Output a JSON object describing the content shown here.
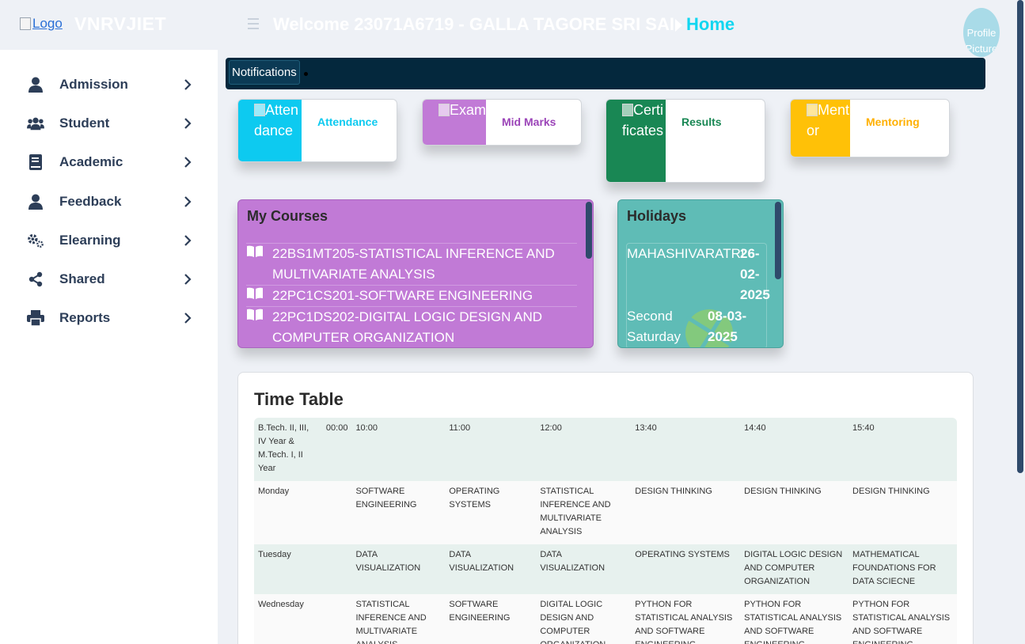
{
  "header": {
    "logo_alt": "Logo",
    "brand": "VNRVJIET",
    "welcome": "Welcome 23071A6719 - GALLA TAGORE SRI SAI",
    "breadcrumb": "Home",
    "avatar_alt": "Profile Picture"
  },
  "sidebar": {
    "items": [
      {
        "label": "Admission",
        "icon": "user-icon"
      },
      {
        "label": "Student",
        "icon": "users-icon"
      },
      {
        "label": "Academic",
        "icon": "book-icon"
      },
      {
        "label": "Feedback",
        "icon": "user-icon"
      },
      {
        "label": "Elearning",
        "icon": "gears-icon"
      },
      {
        "label": "Shared",
        "icon": "share-icon"
      },
      {
        "label": "Reports",
        "icon": "printer-icon"
      }
    ]
  },
  "notifications": {
    "label": "Notifications"
  },
  "quick_cards": [
    {
      "img_alt": "Attendance",
      "label": "Attendance",
      "color": "#0dcaf0"
    },
    {
      "img_alt": "Exam",
      "label": "Mid Marks",
      "color": "#c17ad6"
    },
    {
      "img_alt": "Certificates",
      "label": "Results",
      "color": "#198754"
    },
    {
      "img_alt": "Mentor",
      "label": "Mentoring",
      "color": "#ffc107"
    }
  ],
  "courses": {
    "title": "My Courses",
    "items": [
      {
        "line1": "22BS1MT205-STATISTICAL INFERENCE AND",
        "line2": "MULTIVARIATE ANALYSIS"
      },
      {
        "line1": "22PC1CS201-SOFTWARE ENGINEERING",
        "line2": ""
      },
      {
        "line1": "22PC1DS202-DIGITAL LOGIC DESIGN AND",
        "line2": "COMPUTER ORGANIZATION"
      }
    ]
  },
  "holidays": {
    "title": "Holidays",
    "items": [
      {
        "name": "MAHASHIVARATRI",
        "date_parts": [
          "26-",
          "02-",
          "2025"
        ]
      },
      {
        "name_parts": [
          "Second",
          "Saturday"
        ],
        "date_parts": [
          "08-03-",
          "2025"
        ]
      }
    ]
  },
  "timetable": {
    "title": "Time Table",
    "header": [
      "B.Tech. II, III, IV Year & M.Tech. I, II Year",
      "00:00",
      "10:00",
      "11:00",
      "12:00",
      "13:40",
      "14:40",
      "15:40"
    ],
    "rows": [
      {
        "day": "Monday",
        "slots": [
          "SOFTWARE ENGINEERING",
          "OPERATING SYSTEMS",
          "STATISTICAL INFERENCE AND MULTIVARIATE ANALYSIS",
          "DESIGN THINKING",
          "DESIGN THINKING",
          "DESIGN THINKING"
        ]
      },
      {
        "day": "Tuesday",
        "slots": [
          "DATA VISUALIZATION",
          "DATA VISUALIZATION",
          "DATA VISUALIZATION",
          "OPERATING SYSTEMS",
          "DIGITAL LOGIC DESIGN AND COMPUTER ORGANIZATION",
          "MATHEMATICAL FOUNDATIONS FOR DATA SCIECNE"
        ]
      },
      {
        "day": "Wednesday",
        "slots": [
          "STATISTICAL INFERENCE AND MULTIVARIATE ANALYSIS",
          "SOFTWARE ENGINEERING",
          "DIGITAL LOGIC DESIGN AND COMPUTER ORGANIZATION",
          "PYTHON FOR STATISTICAL ANALYSIS AND SOFTWARE ENGINEERING LABORATORY",
          "PYTHON FOR STATISTICAL ANALYSIS AND SOFTWARE ENGINEERING LABORATORY",
          "PYTHON FOR STATISTICAL ANALYSIS AND SOFTWARE ENGINEERING LABORATORY"
        ]
      }
    ]
  },
  "colors": {
    "courses_bg": "#c17ad6",
    "holidays_bg": "#5fbcb6",
    "header_dark": "#04283d",
    "accent": "#12d6f0"
  }
}
